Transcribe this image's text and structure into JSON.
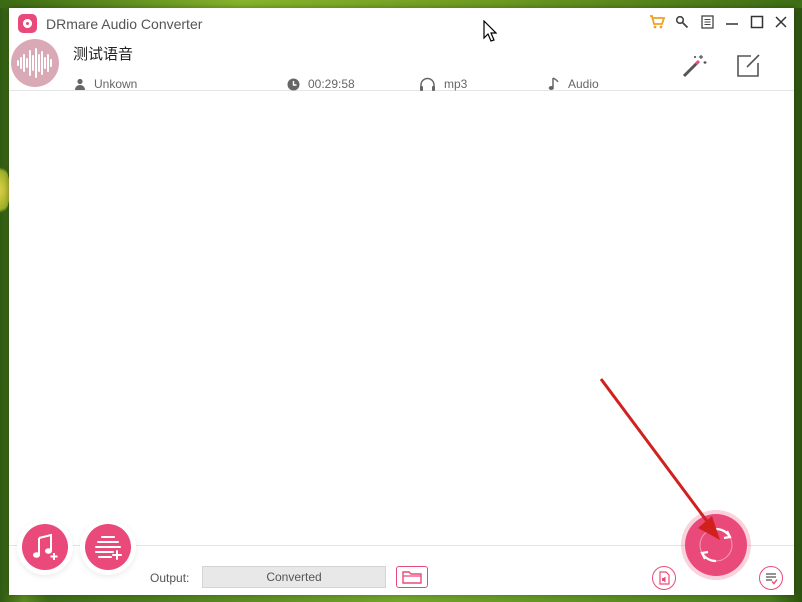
{
  "window": {
    "title": "DRmare Audio Converter",
    "title_icons": [
      "cart-icon",
      "key-icon",
      "menu-icon",
      "minimize-icon",
      "maximize-icon",
      "close-icon"
    ]
  },
  "track": {
    "name": "测试语音",
    "artist": "Unkown",
    "duration": "00:29:58",
    "format": "mp3",
    "type": "Audio",
    "tools": [
      "effect-wand-icon",
      "edit-icon"
    ]
  },
  "bottom": {
    "output_label": "Output:",
    "output_value": "Converted",
    "buttons": [
      "add-music-button",
      "add-playlist-button",
      "open-folder-button",
      "format-button",
      "convert-button",
      "history-button"
    ]
  },
  "colors": {
    "accent": "#ea4a7a",
    "annotation_arrow": "#d0211f"
  }
}
